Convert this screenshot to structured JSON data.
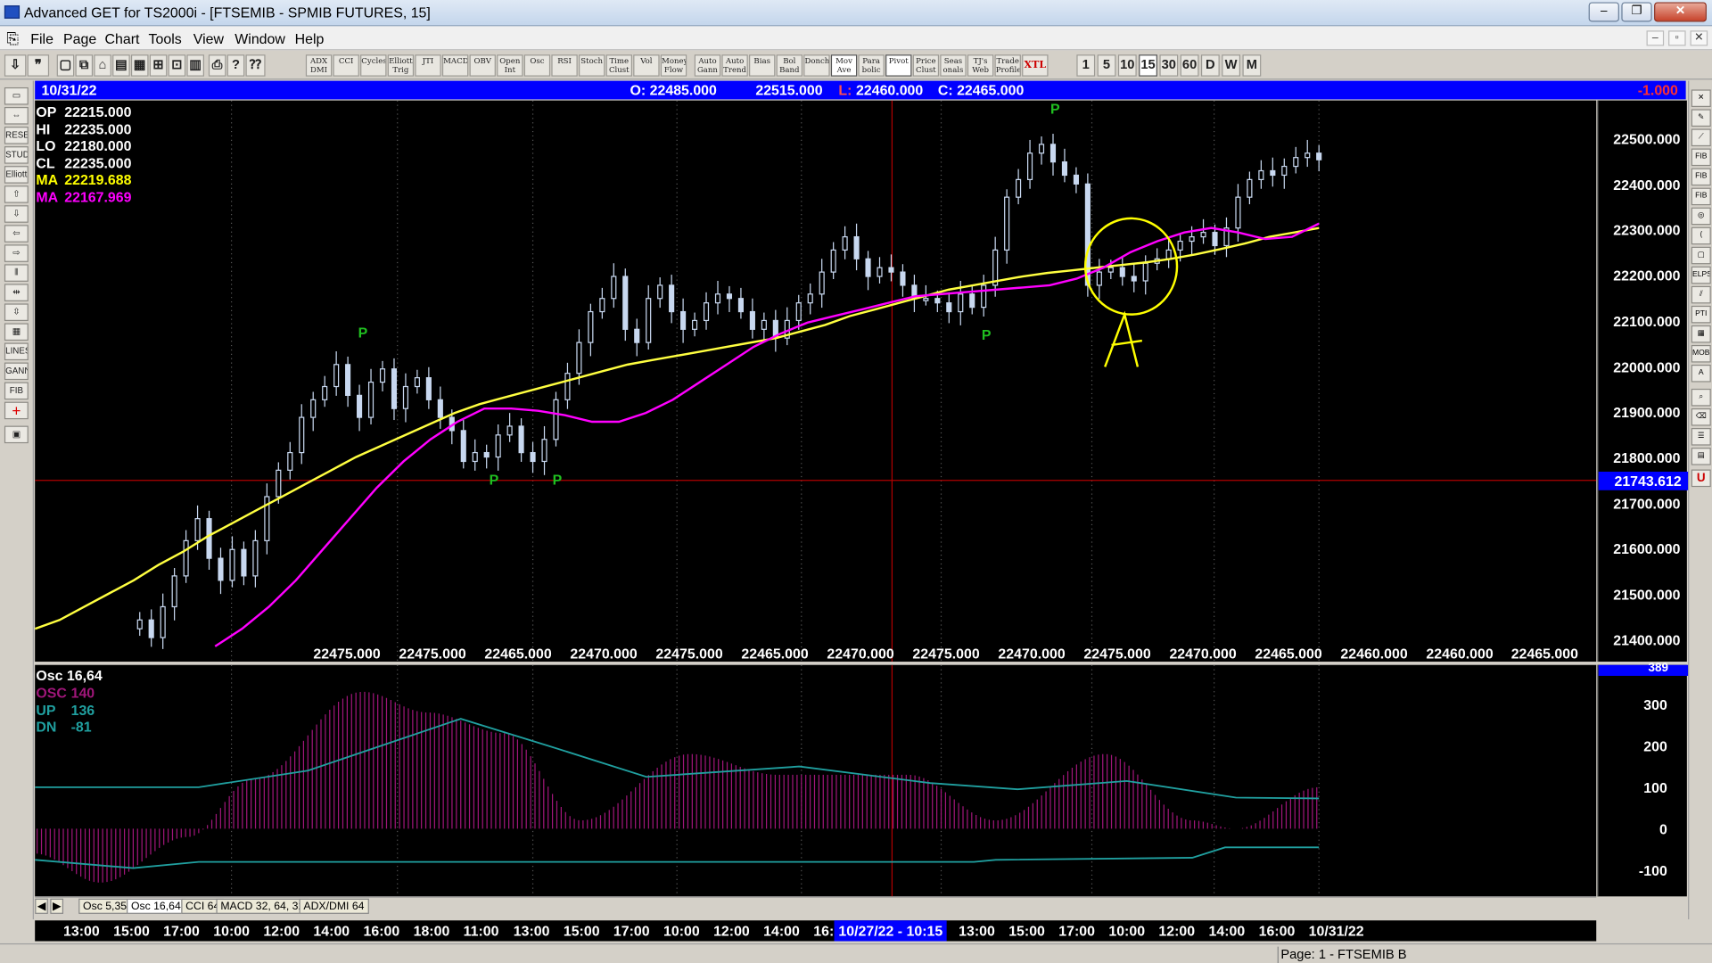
{
  "window": {
    "title": "Advanced GET for TS2000i - [FTSEMIB - SPMIB FUTURES, 15]",
    "min": "–",
    "max": "❐",
    "close": "✕"
  },
  "menu": [
    "File",
    "Page",
    "Chart",
    "Tools",
    "View",
    "Window",
    "Help"
  ],
  "mdi": [
    "–",
    "▫",
    "✕"
  ],
  "toolbar": {
    "studies": [
      "ADX DMI",
      "CCI",
      "Cycles",
      "Elliott Trig",
      "JTI",
      "MACD",
      "OBV",
      "Open Int",
      "Osc",
      "RSI",
      "Stoch",
      "Time Clust",
      "Vol",
      "Money Flow",
      "Auto Gann",
      "Auto Trend",
      "Bias",
      "Bol Band",
      "Donch",
      "Mov Ave",
      "Para bolic",
      "Pivot",
      "Price Clust",
      "Seas onals",
      "TJ's Web",
      "Trade Profile",
      "XTL"
    ],
    "intervals": [
      "1",
      "5",
      "10",
      "15",
      "30",
      "60",
      "D",
      "W",
      "M"
    ],
    "selected_interval": "15"
  },
  "chart_header": {
    "date": "10/31/22",
    "open": "O: 22485.000",
    "high": "22515.000",
    "low_label": "L:",
    "low": "22460.000",
    "close": "C: 22465.000",
    "change": "-1.000"
  },
  "price_panel": {
    "readouts": [
      {
        "label": "OP",
        "value": "22215.000",
        "color": "#ffffff"
      },
      {
        "label": "HI",
        "value": "22235.000",
        "color": "#ffffff"
      },
      {
        "label": "LO",
        "value": "22180.000",
        "color": "#ffffff"
      },
      {
        "label": "CL",
        "value": "22235.000",
        "color": "#ffffff"
      },
      {
        "label": "MA",
        "value": "22219.688",
        "color": "#ffff00"
      },
      {
        "label": "MA",
        "value": "22167.969",
        "color": "#ff00ff"
      }
    ],
    "y_ticks": [
      "22500.000",
      "22400.000",
      "22300.000",
      "22200.000",
      "22100.000",
      "22000.000",
      "21900.000",
      "21800.000",
      "21700.000",
      "21600.000",
      "21500.000",
      "21400.000"
    ],
    "cursor_price": "21743.612",
    "bottom_prices": [
      "22475.000",
      "22475.000",
      "22465.000",
      "22470.000",
      "22475.000",
      "22465.000",
      "22470.000",
      "22475.000",
      "22470.000",
      "22475.000",
      "22470.000",
      "22465.000",
      "22460.000",
      "22460.000"
    ],
    "last_price": "22465.000",
    "pivot_mark": "P",
    "annotation_letter": "A"
  },
  "osc_panel": {
    "title": "Osc 16,64",
    "readouts": [
      {
        "label": "OSC",
        "value": "140",
        "color": "#a0167a"
      },
      {
        "label": "UP",
        "value": "136",
        "color": "#20a0a0"
      },
      {
        "label": "DN",
        "value": "-81",
        "color": "#20a0a0"
      }
    ],
    "y_ticks": [
      "300",
      "200",
      "100",
      "0",
      "-100"
    ],
    "top_value": "389"
  },
  "tabs": [
    "Osc 5,35",
    "Osc 16,64",
    "CCI 64",
    "MACD 32, 64, 32",
    "ADX/DMI 64"
  ],
  "selected_tab": "Osc 16,64",
  "time_axis": [
    "13:00",
    "15:00",
    "17:00",
    "10:00",
    "12:00",
    "14:00",
    "16:00",
    "18:00",
    "11:00",
    "13:00",
    "15:00",
    "17:00",
    "10:00",
    "12:00",
    "14:00",
    "16:"
  ],
  "time_cursor": "10/27/22 - 10:15",
  "time_axis_after": [
    "13:00",
    "15:00",
    "17:00",
    "10:00",
    "12:00",
    "14:00",
    "16:00",
    "10/31/22"
  ],
  "status": {
    "page": "Page: 1 - FTSEMIB B"
  },
  "chart_data": {
    "type": "candlestick",
    "title": "FTSEMIB - SPMIB FUTURES, 15",
    "ylim": [
      21360,
      22560
    ],
    "close_series": [
      21420,
      21380,
      21450,
      21520,
      21600,
      21650,
      21560,
      21510,
      21580,
      21520,
      21600,
      21700,
      21760,
      21800,
      21880,
      21920,
      21950,
      22000,
      21930,
      21880,
      21960,
      21990,
      21900,
      21950,
      21970,
      21920,
      21880,
      21850,
      21780,
      21800,
      21790,
      21840,
      21860,
      21800,
      21780,
      21830,
      21920,
      21980,
      22050,
      22120,
      22150,
      22200,
      22080,
      22050,
      22150,
      22180,
      22120,
      22080,
      22100,
      22140,
      22160,
      22150,
      22120,
      22080,
      22100,
      22060,
      22100,
      22140,
      22160,
      22210,
      22260,
      22290,
      22240,
      22200,
      22220,
      22210,
      22180,
      22150,
      22150,
      22140,
      22120,
      22160,
      22130,
      22180,
      22260,
      22380,
      22420,
      22480,
      22500,
      22460,
      22430,
      22410,
      22180,
      22210,
      22220,
      22200,
      22190,
      22230,
      22240,
      22260,
      22280,
      22290,
      22300,
      22270,
      22310,
      22380,
      22420,
      22440,
      22430,
      22450,
      22470,
      22480,
      22465
    ],
    "ma_yellow": [
      21400,
      21420,
      21450,
      21480,
      21510,
      21545,
      21575,
      21610,
      21640,
      21670,
      21700,
      21730,
      21760,
      21790,
      21815,
      21840,
      21865,
      21890,
      21910,
      21925,
      21940,
      21955,
      21970,
      21985,
      22000,
      22010,
      22020,
      22030,
      22040,
      22050,
      22060,
      22075,
      22090,
      22110,
      22125,
      22140,
      22155,
      22170,
      22180,
      22190,
      22200,
      22208,
      22214,
      22220,
      22226,
      22232,
      22240,
      22250,
      22262,
      22275,
      22290,
      22300,
      22310
    ],
    "ma_magenta": [
      21360,
      21400,
      21450,
      21510,
      21580,
      21650,
      21720,
      21780,
      21830,
      21870,
      21900,
      21900,
      21895,
      21885,
      21870,
      21870,
      21890,
      21920,
      21960,
      22000,
      22040,
      22070,
      22095,
      22110,
      22125,
      22140,
      22155,
      22160,
      22165,
      22170,
      22175,
      22180,
      22195,
      22220,
      22255,
      22280,
      22300,
      22310,
      22300,
      22285,
      22290,
      22320
    ]
  }
}
